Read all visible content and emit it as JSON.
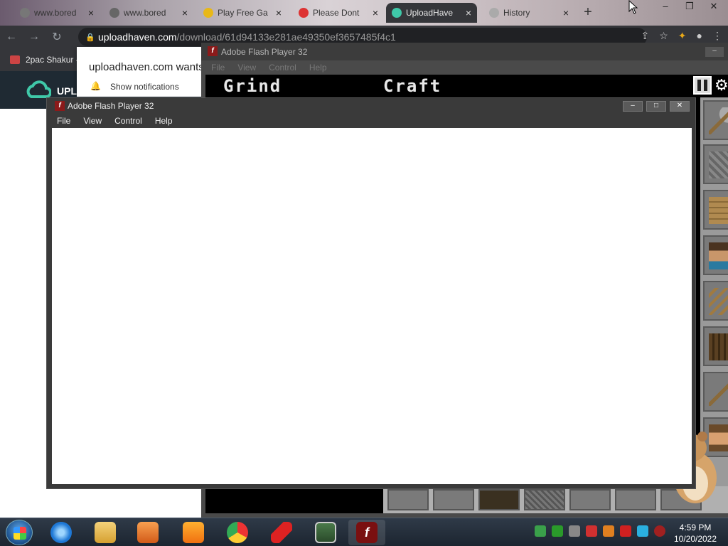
{
  "browser": {
    "tabs": [
      {
        "label": "www.bored",
        "active": false
      },
      {
        "label": "www.bored",
        "active": false
      },
      {
        "label": "Play Free Ga",
        "active": false
      },
      {
        "label": "Please Dont",
        "active": false
      },
      {
        "label": "UploadHave",
        "active": true
      },
      {
        "label": "History",
        "active": false
      }
    ],
    "url_host": "uploadhaven.com",
    "url_path": "/download/61d94133e281ae49350ef3657485f4c1",
    "bookmark": "2pac Shakur -"
  },
  "site": {
    "name": "UPL"
  },
  "notification": {
    "text": "uploadhaven.com wants",
    "option": "Show notifications"
  },
  "flash_back": {
    "title": "Adobe Flash Player 32",
    "menu": [
      "File",
      "View",
      "Control",
      "Help"
    ],
    "game_labels": [
      "Grind",
      "Craft"
    ]
  },
  "flash_front": {
    "title": "Adobe Flash Player 32",
    "menu": [
      "File",
      "View",
      "Control",
      "Help"
    ],
    "min": "–",
    "max": "□",
    "close": "✕"
  },
  "taskbar": {
    "time": "4:59 PM",
    "date": "10/20/2022"
  }
}
